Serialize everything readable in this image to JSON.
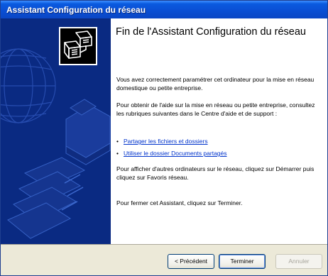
{
  "window": {
    "title": "Assistant Configuration du réseau"
  },
  "heading": "Fin de l'Assistant Configuration du réseau",
  "paragraphs": {
    "intro": "Vous avez correctement paramétrer cet ordinateur pour la mise en réseau domestique ou petite entreprise.",
    "help": "Pour obtenir de l'aide sur la mise en réseau ou petite entreprise, consultez les rubriques suivantes dans le Centre d'aide et de support :",
    "other": "Pour afficher d'autres ordinateurs sur le réseau, cliquez sur Démarrer puis cliquez sur Favoris réseau.",
    "close": "Pour fermer cet Assistant, cliquez sur Terminer."
  },
  "links": [
    {
      "bullet": "•",
      "label": "Partager les fichiers et dossiers"
    },
    {
      "bullet": "•",
      "label": "Utiliser le dossier Documents partagés"
    }
  ],
  "buttons": {
    "back": "< Précédent",
    "finish": "Terminer",
    "cancel": "Annuler"
  },
  "icons": {
    "wizard": "network-computers-icon",
    "watermark": "globe-printer-watermark"
  },
  "colors": {
    "titlebar": "#0a4fd4",
    "sidebar": "#0a2a82",
    "link": "#0033cc"
  }
}
